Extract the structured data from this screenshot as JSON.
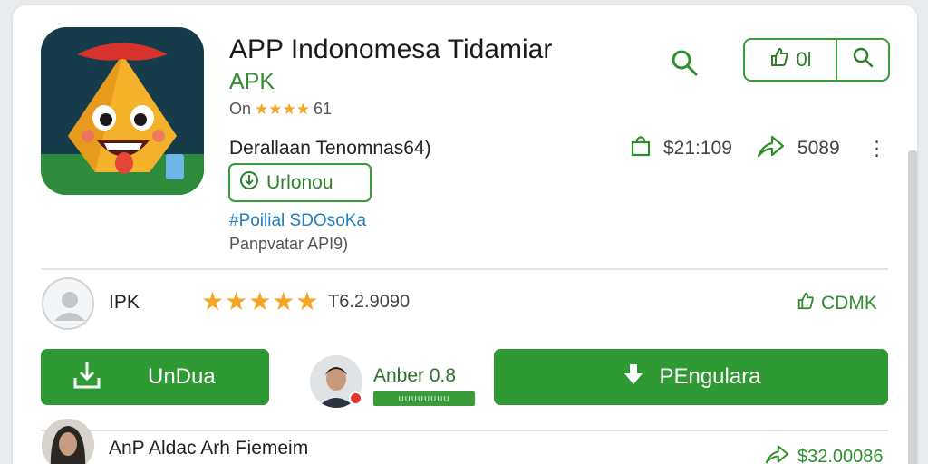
{
  "app": {
    "title": "APP Indonomesa Tidamiar",
    "subtitle": "APK",
    "rating_prefix": "On",
    "rating_stars": "★★★★",
    "rating_suffix": "61",
    "developer": "Derallaan Tenomnas64)",
    "action_label": "Urlonou",
    "hashtag": "#Poilial SDOsoKa",
    "version": "Panpvatar API9)"
  },
  "toolbar": {
    "group_label": "0l"
  },
  "stats": {
    "price": "$21:109",
    "count": "5089"
  },
  "review_row": {
    "name": "IPK",
    "stars": "★★★★★",
    "count": "T6.2.9090",
    "action_label": "CDMK"
  },
  "buttons": {
    "download_label": "UnDua",
    "secondary_label": "PEngularа"
  },
  "promo": {
    "name": "Anber 0.8",
    "badge": "uuuuuuuu"
  },
  "footer_row": {
    "author": "AnP Aldac Arh Fiemeim",
    "price": "$32.00086"
  },
  "colors": {
    "accent": "#2f9a34",
    "star": "#f2a624",
    "link": "#1f7fbf"
  },
  "icons": [
    "search-icon",
    "share-icon",
    "download-icon",
    "bag-icon",
    "trend-icon",
    "more-icon",
    "thumbs-up-icon",
    "user-icon"
  ]
}
